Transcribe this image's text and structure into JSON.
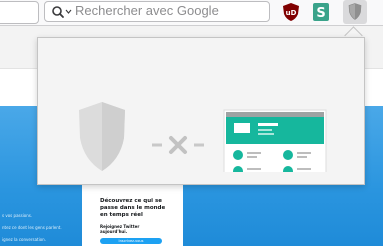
{
  "toolbar": {
    "search": {
      "placeholder": "Rechercher avec Google",
      "icon": "search-icon"
    },
    "extensions": [
      {
        "name": "ublock-origin",
        "label": "uD",
        "color": "#800000"
      },
      {
        "name": "stylus",
        "label": "S",
        "color": "#3aa38a"
      },
      {
        "name": "privacy-shield",
        "color": "#9a9a9a"
      }
    ]
  },
  "popup": {
    "illustration": "shield-blocks-tracker",
    "accent_color": "#16b79d",
    "cross_icon": "close-icon"
  },
  "background_page": {
    "list_lines": [
      "s vos passions.",
      "ntez ce dont les gens parlent.",
      "ignez la conversation."
    ],
    "heading": "Découvrez ce qui se passe dans le monde en temps réel",
    "subheading": "Rejoignez Twitter aujourd'hui.",
    "button": "Inscrivez-vous"
  }
}
